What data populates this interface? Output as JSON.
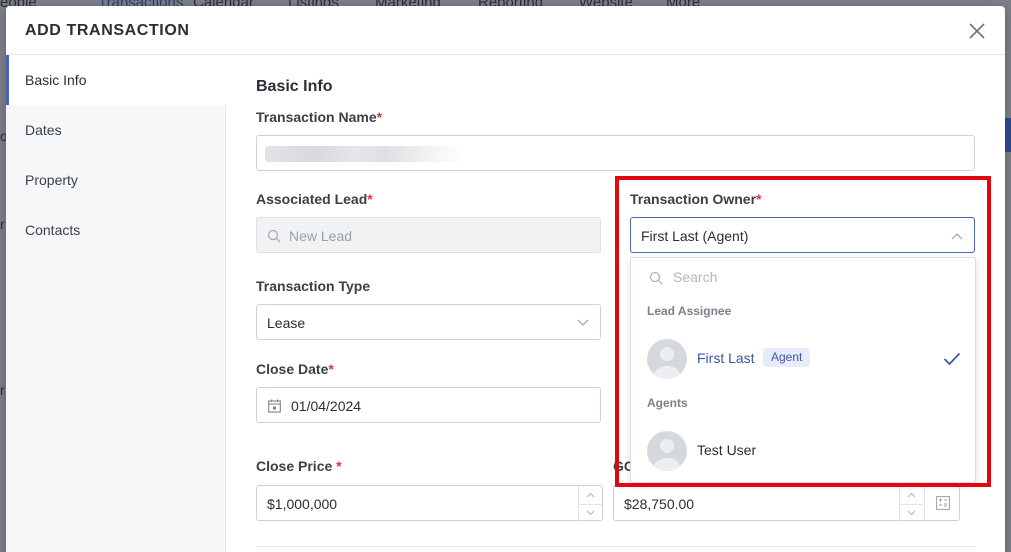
{
  "background_nav": {
    "items": [
      "eople",
      "Transactions",
      "Calendar",
      "Listings",
      "Marketing",
      "Reporting",
      "Website",
      "More"
    ],
    "fragments": [
      "o",
      "r",
      "r"
    ]
  },
  "modal": {
    "title": "ADD TRANSACTION",
    "close_icon": "close-icon"
  },
  "sidebar": {
    "items": [
      {
        "label": "Basic Info",
        "active": true
      },
      {
        "label": "Dates",
        "active": false
      },
      {
        "label": "Property",
        "active": false
      },
      {
        "label": "Contacts",
        "active": false
      }
    ]
  },
  "form": {
    "section_title": "Basic Info",
    "transaction_name": {
      "label": "Transaction Name",
      "required_mark": "*"
    },
    "associated_lead": {
      "label": "Associated Lead",
      "required_mark": "*",
      "placeholder": "New Lead"
    },
    "transaction_owner": {
      "label": "Transaction Owner",
      "required_mark": "*",
      "value": "First Last (Agent)"
    },
    "transaction_type": {
      "label": "Transaction Type",
      "value": "Lease"
    },
    "close_date": {
      "label": "Close Date",
      "required_mark": "*",
      "value": "01/04/2024"
    },
    "close_price": {
      "label": "Close Price",
      "required_mark": "*",
      "value": "$1,000,000"
    },
    "gci": {
      "label_fragment": "GC",
      "value": "$28,750.00"
    }
  },
  "owner_dropdown": {
    "search_placeholder": "Search",
    "groups": [
      {
        "label": "Lead Assignee",
        "options": [
          {
            "name": "First Last",
            "badge": "Agent",
            "selected": true
          }
        ]
      },
      {
        "label": "Agents",
        "options": [
          {
            "name": "Test User",
            "selected": false
          }
        ]
      }
    ]
  },
  "colors": {
    "accent": "#3c56a8",
    "required": "#d9393e",
    "highlight": "#e3080e"
  }
}
